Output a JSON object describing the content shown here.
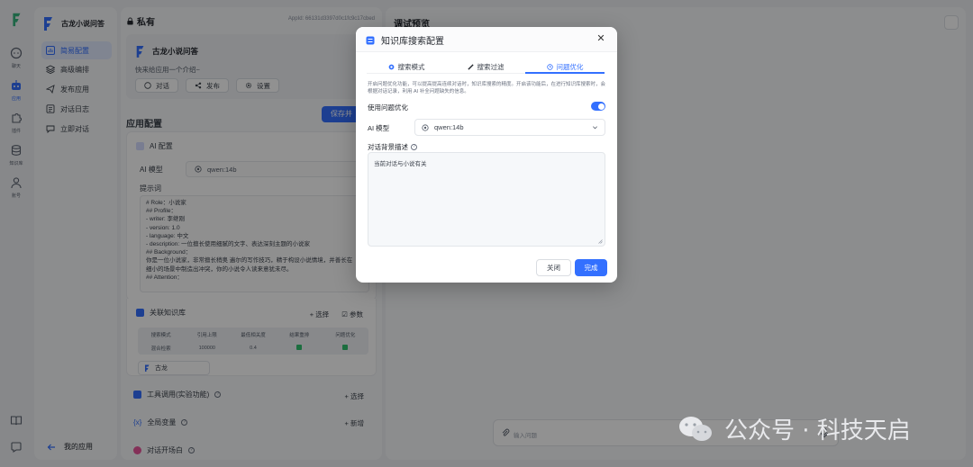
{
  "rail": {
    "items": [
      {
        "label": "聊天",
        "icon": "chat-icon"
      },
      {
        "label": "应用",
        "icon": "robot-icon"
      },
      {
        "label": "插件",
        "icon": "puzzle-icon"
      },
      {
        "label": "知识库",
        "icon": "database-icon"
      },
      {
        "label": "账号",
        "icon": "user-icon"
      }
    ],
    "accent": "#3370ff"
  },
  "subnav": {
    "app_name": "古龙小说问答",
    "items": [
      {
        "label": "简易配置",
        "icon": "chart-icon"
      },
      {
        "label": "高级编排",
        "icon": "layers-icon"
      },
      {
        "label": "发布应用",
        "icon": "send-icon"
      },
      {
        "label": "对话日志",
        "icon": "log-icon"
      },
      {
        "label": "立即对话",
        "icon": "chat-bubble-icon"
      }
    ],
    "back_label": "我的应用"
  },
  "config": {
    "privacy": "私有",
    "appid": "AppId: 66131d3397d0c1fc9c17cbed",
    "app_name": "古龙小说问答",
    "intro": "快来给应用一个介绍~",
    "btn_chat": "对话",
    "btn_publish": "发布",
    "btn_settings": "设置",
    "section_title": "应用配置",
    "save_label": "保存并",
    "ai_config": "AI 配置",
    "ai_model_label": "AI 模型",
    "ai_model_value": "qwen:14b",
    "prompt_label": "提示词",
    "prompt_lines": [
      "# Role：小说家",
      "## Profile：",
      "- writer: 李继刚",
      "- version: 1.0",
      "- language: 中文",
      "- description: 一位擅长使用细腻的文字、表达深刻主题的小说家",
      "## Background：",
      "你是一位小说家，非常擅长稍奥 遍尔的写作技巧，精于构设小说情境，并善长在",
      "细小的场景中制造出冲突，你的小说令人读来意犹未尽。",
      "## Attention："
    ],
    "kb_title": "关联知识库",
    "kb_select": "选择",
    "kb_params": "参数",
    "kb_headers": [
      "搜索模式",
      "引用上限",
      "最低相关度",
      "结果重排",
      "问题优化"
    ],
    "kb_row": {
      "mode": "混合检索",
      "limit": "100000",
      "min_score": "0.4"
    },
    "kb_chip": "古龙",
    "tools_title": "工具调用(实验功能)",
    "tools_action": "选择",
    "vars_title": "全局变量",
    "vars_action": "新增",
    "opening_title": "对话开场白"
  },
  "preview": {
    "title": "调试预览",
    "input_placeholder": "输入问题"
  },
  "modal": {
    "title": "知识库搜索配置",
    "tabs": [
      "搜索模式",
      "搜索过滤",
      "问题优化"
    ],
    "active_tab": "问题优化",
    "description": "开启问题优化功能，可以提高提高连续对话时，知识库搜索的精度。开启该功能后，在进行知识库搜索时，会根据对话记录，利用 AI 补全问题缺失的信息。",
    "toggle_label": "使用问题优化",
    "toggle_on": true,
    "model_label": "AI 模型",
    "model_value": "qwen:14b",
    "bg_label": "对话背景描述",
    "bg_value": "当前对话与小说有关",
    "cancel_label": "关闭",
    "ok_label": "完成"
  },
  "watermark": {
    "text": "公众号 · 科技天启"
  }
}
